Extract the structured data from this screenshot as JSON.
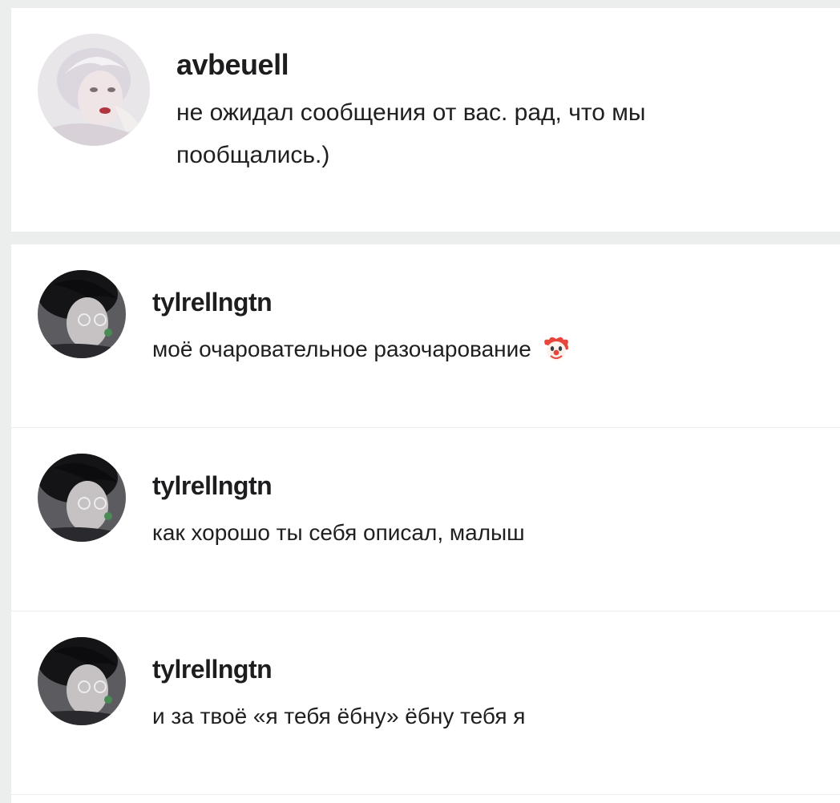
{
  "comments": [
    {
      "username": "avbeuell",
      "text_line1": "не ожидал сообщения от вас. рад, что мы",
      "text_line2": "пообщались.)",
      "avatar": "user-avatar-light-hair"
    },
    {
      "username": "tylrellngtn",
      "text": "моё очаровательное разочарование",
      "emoji": "clown-face-icon",
      "avatar": "user-avatar-dark"
    },
    {
      "username": "tylrellngtn",
      "text": "как хорошо ты себя описал, малыш",
      "avatar": "user-avatar-dark"
    },
    {
      "username": "tylrellngtn",
      "text": "и за твоё «я тебя ёбну» ёбну тебя я",
      "avatar": "user-avatar-dark"
    }
  ]
}
